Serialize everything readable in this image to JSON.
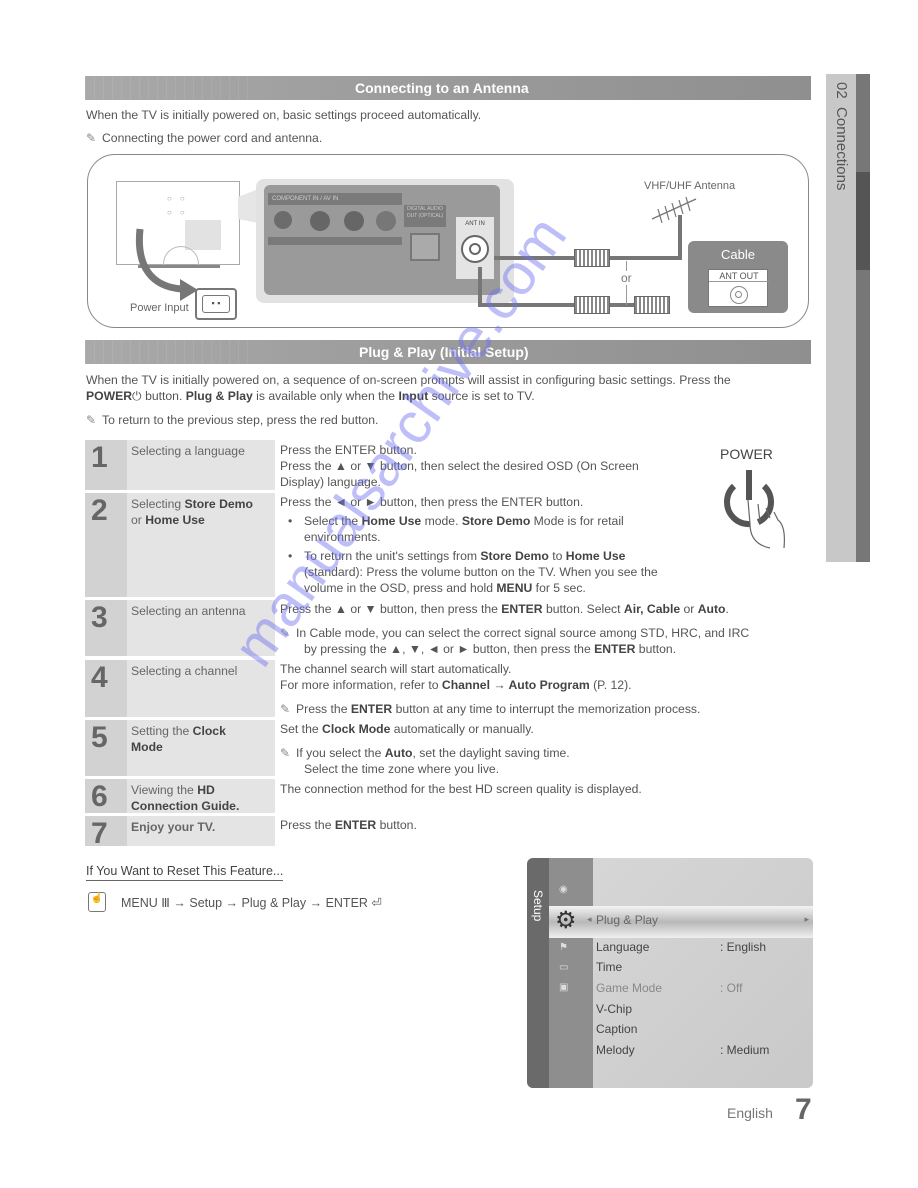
{
  "side_tab": {
    "chapter": "02",
    "label": "Connections"
  },
  "antenna_section": {
    "title": "Connecting to an Antenna",
    "intro": "When the TV is initially powered on, basic settings proceed automatically.",
    "note": "Connecting the power cord and antenna.",
    "diagram": {
      "power_input_label": "Power Input",
      "panel_label_component": "COMPONENT IN / AV IN",
      "panel_label_audio": "DIGITAL AUDIO OUT (OPTICAL)",
      "ant_in_label": "ANT IN",
      "antenna_label": "VHF/UHF Antenna",
      "or_label": "or",
      "cable_label": "Cable",
      "ant_out_label": "ANT OUT"
    }
  },
  "plug_play_section": {
    "title": "Plug & Play (Initial Setup)",
    "intro_1": "When the TV is initially powered on, a sequence of on-screen prompts will assist in configuring basic settings. Press the",
    "intro_power": "POWER",
    "intro_2": " button. ",
    "intro_plug": "Plug & Play",
    "intro_3": " is available only when the ",
    "intro_input": "Input",
    "intro_4": " source is set to TV.",
    "note": "To return to the previous step, press the red button.",
    "power_button_label": "POWER",
    "steps": [
      {
        "num": "1",
        "title": "Selecting a language",
        "lines": [
          "Press the ENTER button.",
          "Press the ▲ or ▼ button, then select the desired OSD (On Screen",
          "Display) language."
        ]
      },
      {
        "num": "2",
        "title_a": "Selecting ",
        "title_b": "Store Demo",
        "title_c": "or ",
        "title_d": "Home Use",
        "line1": "Press the ◄ or ► button, then press the ENTER button.",
        "bullet1_a": "Select the ",
        "bullet1_b": "Home Use",
        "bullet1_c": " mode. ",
        "bullet1_d": "Store Demo",
        "bullet1_e": " Mode is for retail",
        "bullet1_f": "environments.",
        "bullet2_a": "To return the unit's settings from ",
        "bullet2_b": "Store Demo",
        "bullet2_c": " to ",
        "bullet2_d": "Home Use",
        "bullet2_e": "(standard): Press the volume button on the TV. When you see the",
        "bullet2_f": "volume in the OSD, press and hold ",
        "bullet2_g": "MENU",
        "bullet2_h": " for 5 sec."
      },
      {
        "num": "3",
        "title": "Selecting an antenna",
        "line1_a": "Press the ▲ or ▼ button, then press the ",
        "line1_b": "ENTER",
        "line1_c": " button. Select ",
        "line1_d": "Air, Cable",
        "line1_e": " or ",
        "line1_f": "Auto",
        "note_1": "In Cable mode, you can select the correct signal source among STD, HRC, and IRC",
        "note_2a": "by pressing the ▲, ▼, ◄ or ► button, then press the ",
        "note_2b": "ENTER",
        "note_2c": " button."
      },
      {
        "num": "4",
        "title": "Selecting a channel",
        "line1": "The channel search will start automatically.",
        "line2_a": "For more information, refer to ",
        "line2_b": "Channel → Auto Program",
        "line2_c": " (P. 12).",
        "note_a": "Press the ",
        "note_b": "ENTER",
        "note_c": " button at any time to interrupt the memorization process."
      },
      {
        "num": "5",
        "title_a": "Setting the ",
        "title_b": "Clock",
        "title_c": "Mode",
        "line1_a": "Set the ",
        "line1_b": "Clock Mode",
        "line1_c": " automatically or manually.",
        "note_a": "If you select the ",
        "note_b": "Auto",
        "note_c": ", set the daylight saving time.",
        "note_2": "Select the time zone where you live."
      },
      {
        "num": "6",
        "title_a": "Viewing the ",
        "title_b": "HD",
        "title_c": "Connection Guide.",
        "line1": "The connection method for the best HD screen quality is displayed."
      },
      {
        "num": "7",
        "title": "Enjoy your TV.",
        "line1_a": "Press the ",
        "line1_b": "ENTER",
        "line1_c": " button."
      }
    ]
  },
  "reset_section": {
    "heading": "If You Want to Reset This Feature...",
    "path": [
      "MENU",
      "Setup",
      "Plug & Play",
      "ENTER"
    ]
  },
  "tv_menu": {
    "tab": "Setup",
    "selected": "Plug & Play",
    "items": [
      {
        "label": "Language",
        "value": ": English"
      },
      {
        "label": "Time",
        "value": ""
      },
      {
        "label": "Game Mode",
        "value": ": Off"
      },
      {
        "label": "V-Chip",
        "value": ""
      },
      {
        "label": "Caption",
        "value": ""
      },
      {
        "label": "Melody",
        "value": ": Medium"
      }
    ]
  },
  "footer": {
    "language": "English",
    "page_number": "7"
  },
  "watermark": "manualsarchive.com"
}
